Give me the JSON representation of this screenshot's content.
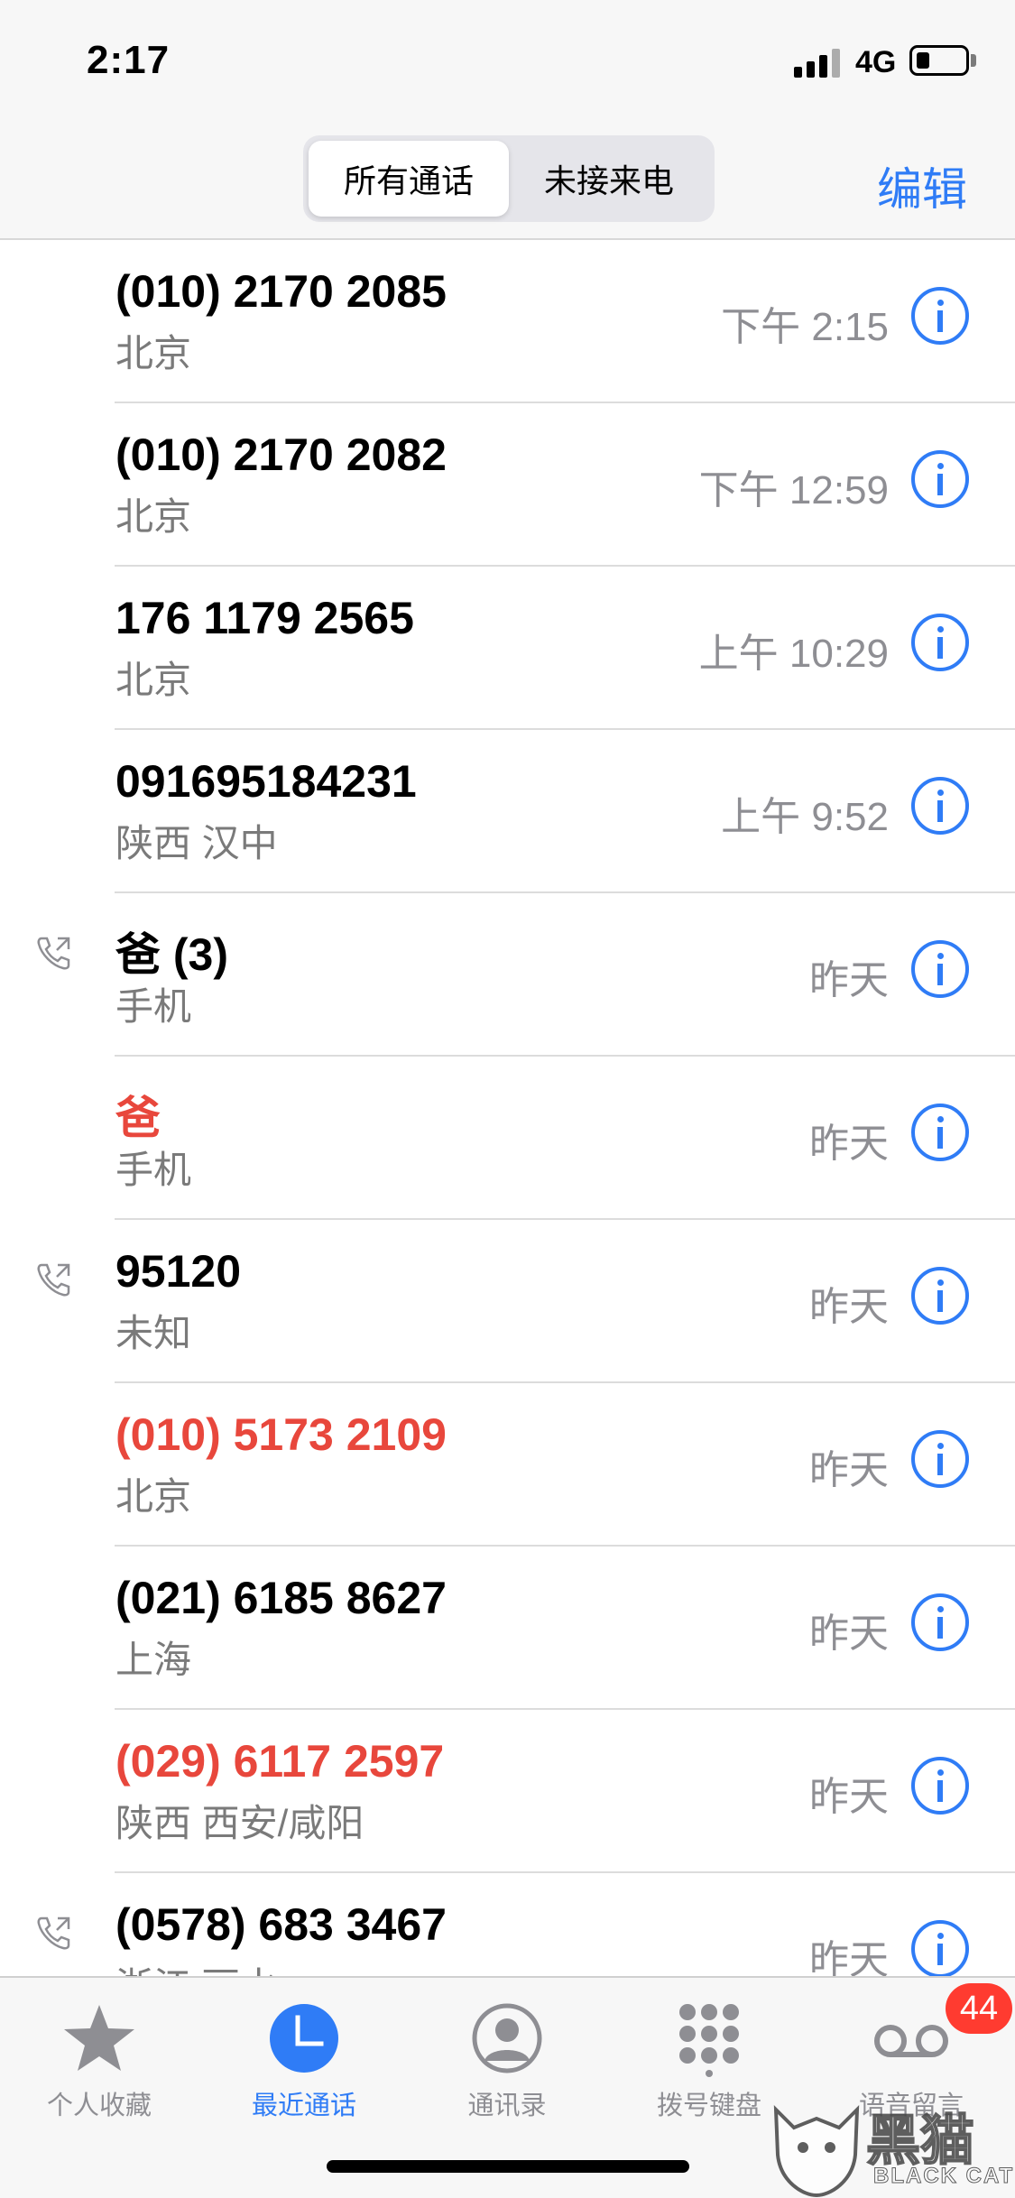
{
  "status_bar": {
    "time": "2:17",
    "network": "4G"
  },
  "header": {
    "segments": [
      {
        "label": "所有通话",
        "active": true
      },
      {
        "label": "未接来电",
        "active": false
      }
    ],
    "edit_label": "编辑"
  },
  "calls": [
    {
      "name": "(010) 2170 2085",
      "sub": "北京",
      "time": "下午 2:15",
      "missed": false,
      "outgoing": false
    },
    {
      "name": "(010) 2170 2082",
      "sub": "北京",
      "time": "下午 12:59",
      "missed": false,
      "outgoing": false
    },
    {
      "name": "176 1179 2565",
      "sub": "北京",
      "time": "上午 10:29",
      "missed": false,
      "outgoing": false
    },
    {
      "name": "091695184231",
      "sub": "陕西 汉中",
      "time": "上午 9:52",
      "missed": false,
      "outgoing": false
    },
    {
      "name": "爸 (3)",
      "sub": "手机",
      "time": "昨天",
      "missed": false,
      "outgoing": true
    },
    {
      "name": "爸",
      "sub": "手机",
      "time": "昨天",
      "missed": true,
      "outgoing": false
    },
    {
      "name": "95120",
      "sub": "未知",
      "time": "昨天",
      "missed": false,
      "outgoing": true
    },
    {
      "name": "(010) 5173 2109",
      "sub": "北京",
      "time": "昨天",
      "missed": true,
      "outgoing": false
    },
    {
      "name": "(021) 6185 8627",
      "sub": "上海",
      "time": "昨天",
      "missed": false,
      "outgoing": false
    },
    {
      "name": "(029) 6117 2597",
      "sub": "陕西 西安/咸阳",
      "time": "昨天",
      "missed": true,
      "outgoing": false
    },
    {
      "name": "(0578) 683 3467",
      "sub": "浙江 丽水",
      "time": "昨天",
      "missed": false,
      "outgoing": true
    }
  ],
  "tab_bar": {
    "tabs": [
      {
        "label": "个人收藏",
        "icon": "star-icon",
        "active": false
      },
      {
        "label": "最近通话",
        "icon": "clock-icon",
        "active": true
      },
      {
        "label": "通讯录",
        "icon": "contacts-icon",
        "active": false
      },
      {
        "label": "拨号键盘",
        "icon": "keypad-icon",
        "active": false
      },
      {
        "label": "语音留言",
        "icon": "voicemail-icon",
        "active": false
      }
    ],
    "voicemail_badge": "44"
  },
  "watermark": {
    "cn": "黑猫",
    "en": "BLACK CAT"
  },
  "colors": {
    "accent": "#2f7cf6",
    "missed": "#e8473c",
    "badge": "#ff3b30"
  }
}
